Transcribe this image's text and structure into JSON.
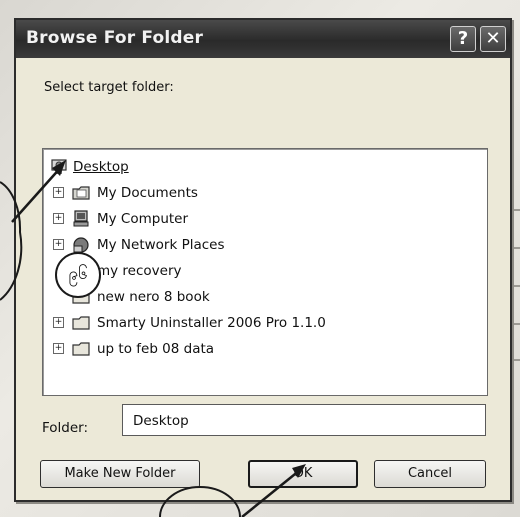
{
  "dialog": {
    "title": "Browse For Folder",
    "help_glyph": "?",
    "close_glyph": "✕",
    "instruction": "Select target folder:"
  },
  "tree": {
    "items": [
      {
        "label": "Desktop",
        "icon": "desktop-icon",
        "selected": true
      },
      {
        "label": "My Documents",
        "icon": "documents-folder-icon",
        "expander": "+"
      },
      {
        "label": "My Computer",
        "icon": "computer-icon",
        "expander": "+"
      },
      {
        "label": "My Network Places",
        "icon": "network-places-icon",
        "expander": "+"
      },
      {
        "label": "my recovery",
        "icon": "folder-icon"
      },
      {
        "label": "new nero 8 book",
        "icon": "folder-icon"
      },
      {
        "label": "Smarty Uninstaller 2006 Pro 1.1.0",
        "icon": "folder-icon",
        "expander": "+"
      },
      {
        "label": "up to feb 08 data",
        "icon": "folder-icon",
        "expander": "+"
      }
    ]
  },
  "folder_field": {
    "label": "Folder:",
    "value": "Desktop"
  },
  "buttons": {
    "make_new_folder": "Make New Folder",
    "ok": "OK",
    "cancel": "Cancel"
  },
  "annotation": {
    "circle_text": "၉၆"
  },
  "colors": {
    "titlebar": "#2a2a2a",
    "dialog_face": "#ece9d8",
    "tree_bg": "#ffffff"
  }
}
